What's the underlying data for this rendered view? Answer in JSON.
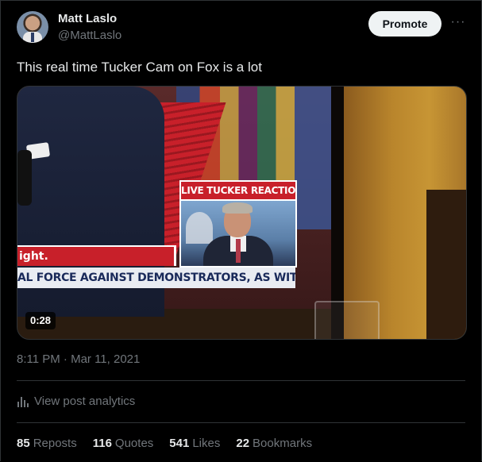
{
  "author": {
    "name": "Matt Laslo",
    "handle": "@MattLaslo"
  },
  "header": {
    "promote_label": "Promote",
    "more_label": "···"
  },
  "tweet": {
    "text": "This real time Tucker Cam on Fox is a lot",
    "timestamp": "8:11 PM · Mar 11, 2021"
  },
  "media": {
    "inset_label": "LIVE TUCKER REACTION",
    "chyron_top": "ight.",
    "chyron_bottom": "AL FORCE AGAINST DEMONSTRATORS, AS WIT",
    "duration": "0:28"
  },
  "analytics": {
    "label": "View post analytics",
    "icon": "bar-chart-icon"
  },
  "stats": [
    {
      "value": "85",
      "label": "Reposts"
    },
    {
      "value": "116",
      "label": "Quotes"
    },
    {
      "value": "541",
      "label": "Likes"
    },
    {
      "value": "22",
      "label": "Bookmarks"
    }
  ],
  "colors": {
    "background": "#000000",
    "text": "#e7e9ea",
    "muted": "#71767b",
    "border": "#2f3336",
    "promote_bg": "#eff3f4"
  }
}
